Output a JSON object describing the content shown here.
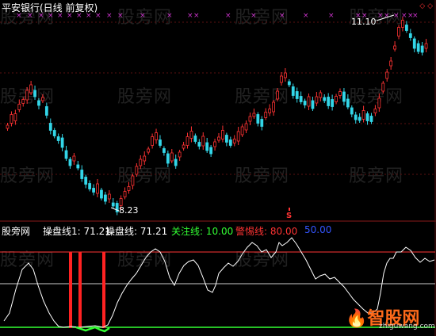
{
  "chart_title": "平安银行(日线 前复权)",
  "corner_icons": "◇ ◇",
  "price_high_label": "11.10",
  "price_low_label": "8.23",
  "marker_s": "S",
  "indicator": {
    "source": "股旁网",
    "name_line1": "操盘线1: 71.21",
    "name_line2": "操盘线: 71.21",
    "focus_label": "关注线: 10.00",
    "alert_label": "警惕线: 80.00",
    "mid_label": "50.00"
  },
  "watermark": "股旁网",
  "logo": {
    "text": "智股网",
    "url": "zhiguwang.com"
  },
  "colors": {
    "up": "#ff3333",
    "down": "#33d6e8",
    "white_line": "#ffffff",
    "focus": "#33ff33",
    "alert": "#ff3333",
    "mid": "#3333ff",
    "x_marks": "#cc33cc"
  }
}
